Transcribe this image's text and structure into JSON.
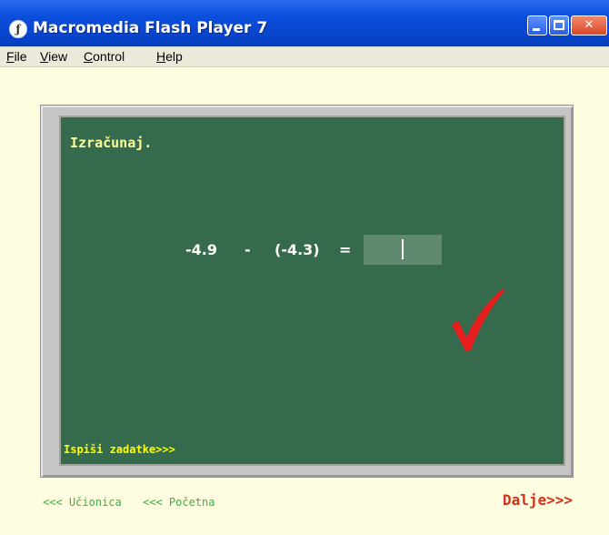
{
  "window": {
    "title": "Macromedia Flash Player 7",
    "icon": "flash-player-icon",
    "title_color": "#0a46cf"
  },
  "menubar": {
    "items": [
      {
        "label": "File",
        "accel": "F",
        "rest": "ile"
      },
      {
        "label": "View",
        "accel": "V",
        "rest": "iew"
      },
      {
        "label": "Control",
        "accel": "C",
        "rest": "ontrol"
      },
      {
        "label": "Help",
        "accel": "H",
        "rest": "elp"
      }
    ]
  },
  "board": {
    "instruction": "Izračunaj.",
    "expression": {
      "operand1": "-4.9",
      "operator": "-",
      "operand2": "(-4.3)",
      "equals": "="
    },
    "answer_value": "",
    "feedback_icon": "checkmark-icon",
    "feedback_color": "#e81e1e",
    "board_color": "#356b4c",
    "print_link": "Ispiši zadatke>>>"
  },
  "navigation": {
    "back_classroom": "<<< Učionica",
    "back_home": "<<< Početna",
    "next": "Dalje>>>"
  }
}
